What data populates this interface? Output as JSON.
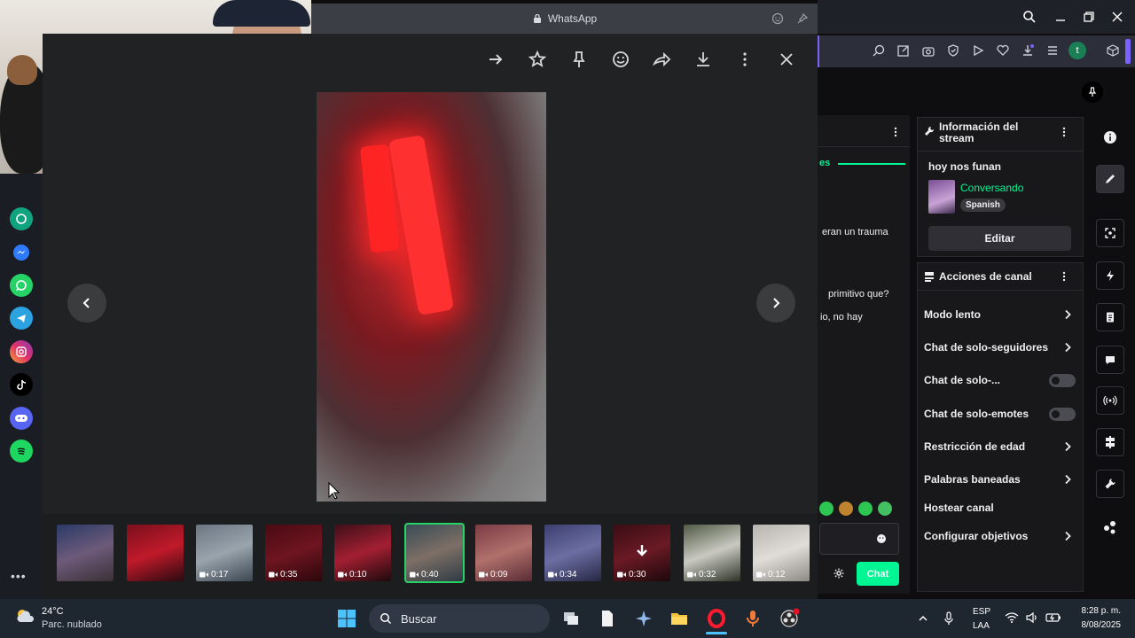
{
  "whatsapp": {
    "title": "WhatsApp",
    "toolbar": [
      "forward-arrow",
      "star",
      "pin",
      "emoji",
      "share",
      "download",
      "more",
      "close"
    ],
    "thumbnails": [
      {
        "duration": ""
      },
      {
        "duration": ""
      },
      {
        "duration": "0:17"
      },
      {
        "duration": "0:35"
      },
      {
        "duration": "0:10"
      },
      {
        "duration": "0:40",
        "selected": true
      },
      {
        "duration": "0:09"
      },
      {
        "duration": "0:34"
      },
      {
        "duration": "0:30"
      },
      {
        "duration": "0:32"
      },
      {
        "duration": "0:12"
      }
    ]
  },
  "chat": {
    "partial_lines": [
      "es",
      "eran un trauma",
      "primitivo que?",
      "io, no hay"
    ],
    "send_label": "Chat"
  },
  "stream_info": {
    "header": "Información del stream",
    "title": "hoy nos funan",
    "category": "Conversando",
    "language": "Spanish",
    "edit_label": "Editar"
  },
  "channel_actions": {
    "header": "Acciones de canal",
    "items": [
      {
        "label": "Modo lento",
        "control": "chevron"
      },
      {
        "label": "Chat de solo-seguidores",
        "control": "chevron"
      },
      {
        "label": "Chat de solo-...",
        "control": "toggle"
      },
      {
        "label": "Chat de solo-emotes",
        "control": "toggle"
      },
      {
        "label": "Restricción de edad",
        "control": "chevron"
      },
      {
        "label": "Palabras baneadas",
        "control": "chevron"
      },
      {
        "label": "Hostear canal",
        "control": "none"
      },
      {
        "label": "Configurar objetivos",
        "control": "chevron"
      }
    ]
  },
  "taskbar": {
    "weather_temp": "24°C",
    "weather_desc": "Parc. nublado",
    "search_placeholder": "Buscar",
    "lang_top": "ESP",
    "lang_bottom": "LAA",
    "time": "8:28 p. m.",
    "date": "8/08/2025"
  },
  "colors": {
    "whatsapp_green": "#25d366",
    "twitch_green": "#00f593",
    "accent_purple": "#7b61ff"
  }
}
